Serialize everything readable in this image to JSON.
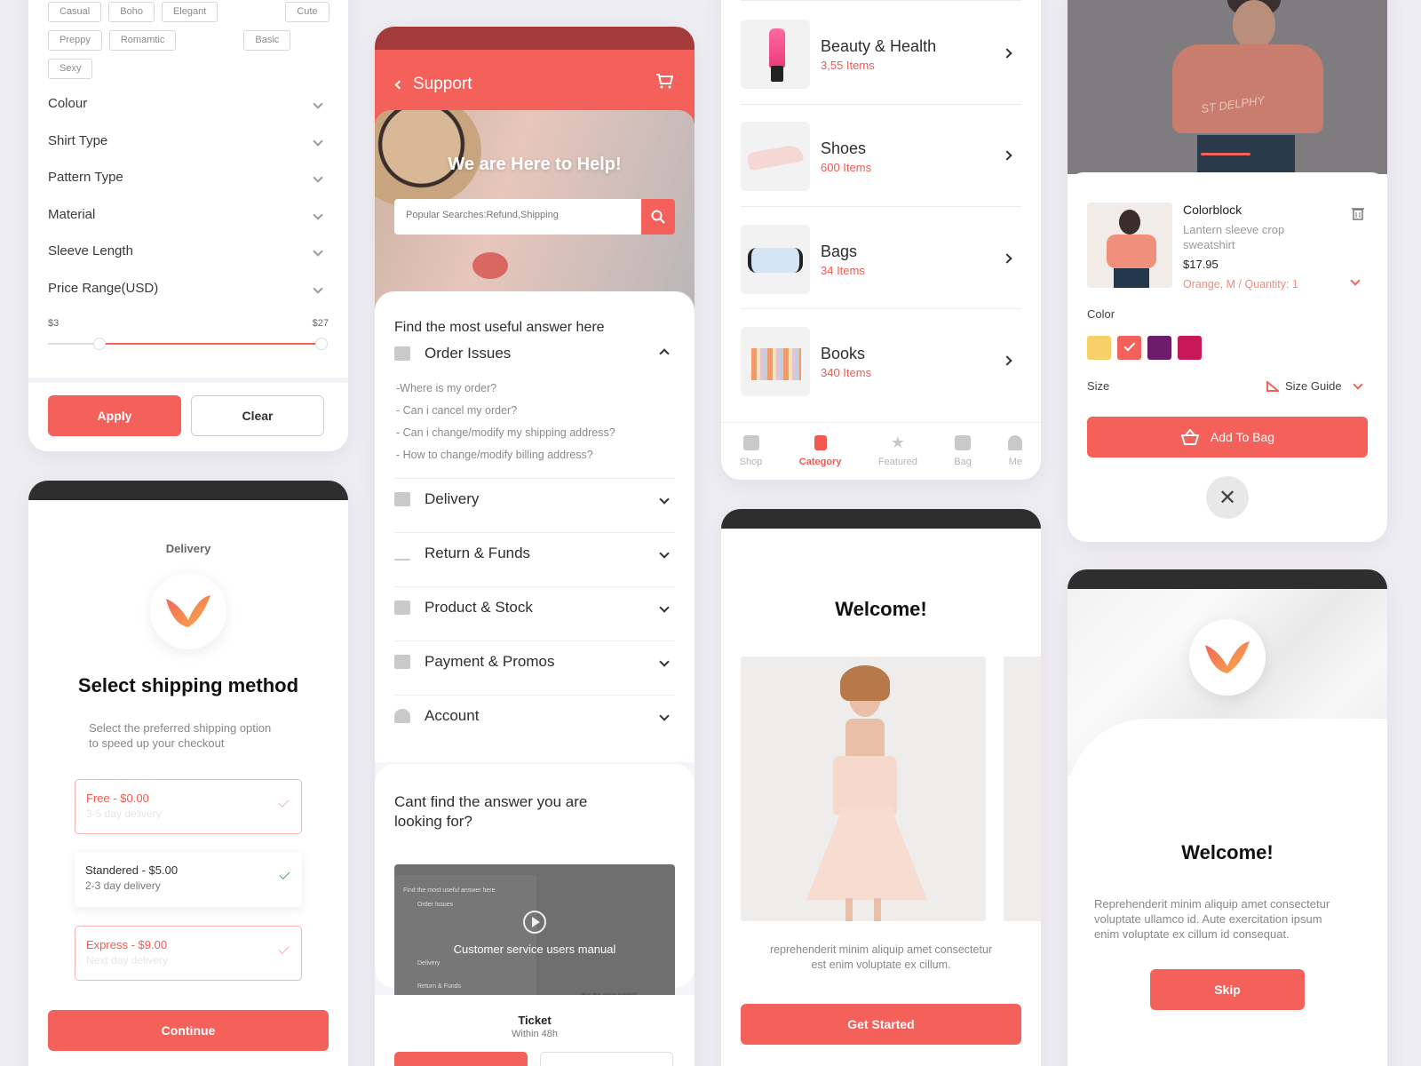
{
  "filter": {
    "tags": [
      "Casual",
      "Boho",
      "Elegant",
      "Cute",
      "Preppy",
      "Romamtic",
      "Basic",
      "Sexy"
    ],
    "rows": [
      "Colour",
      "Shirt Type",
      "Pattern Type",
      "Material",
      "Sleeve Length",
      "Price Range(USD)"
    ],
    "price_min": "$3",
    "price_max": "$27",
    "apply_label": "Apply",
    "clear_label": "Clear"
  },
  "shipping": {
    "header": "Delivery",
    "title": "Select shipping method",
    "subtitle_line1": "Select the preferred shipping option",
    "subtitle_line2": "to speed up your checkout",
    "options": [
      {
        "title": "Free - $0.00",
        "sub": "3-5 day delivery"
      },
      {
        "title": "Standered - $5.00",
        "sub": "2-3 day delivery"
      },
      {
        "title": "Express - $9.00",
        "sub": "Next day delivery"
      }
    ],
    "continue_label": "Continue"
  },
  "support": {
    "title": "Support",
    "hero_title": "We are Here to Help!",
    "search_placeholder": "Popular Searches:Refund,Shipping",
    "section_title": "Find the most useful answer here",
    "open_topic": "Order Issues",
    "questions": [
      "-Where is my order?",
      "- Can i cancel my order?",
      "- Can i change/modify my shipping address?",
      "- How to change/modify billing address?"
    ],
    "topics": [
      "Delivery",
      "Return & Funds",
      "Product & Stock",
      "Payment & Promos",
      "Account"
    ],
    "cant_find_line1": "Cant find the answer you are",
    "cant_find_line2": "looking for?",
    "video_caption": "Customer service users manual",
    "video_mini": {
      "title": "Find the most useful answer here",
      "topic": "Order Issues",
      "row1": "Delivery",
      "row2": "Return & Funds",
      "footer": "Was this article helpful?"
    },
    "ticket_title": "Ticket",
    "ticket_sub": "Within 48h"
  },
  "categories": {
    "items": [
      {
        "name": "Beauty & Health",
        "count": "3,55 Items"
      },
      {
        "name": "Shoes",
        "count": "600 Items"
      },
      {
        "name": "Bags",
        "count": "34 Items"
      },
      {
        "name": "Books",
        "count": "340 Items"
      }
    ],
    "tabs": [
      "Shop",
      "Category",
      "Featured",
      "Bag",
      "Me"
    ],
    "active_tab": "Category"
  },
  "welcome": {
    "title": "Welcome!",
    "text_line1": "reprehenderit minim aliquip amet consectetur",
    "text_line2": "est enim voluptate ex cillum.",
    "cta": "Get Started"
  },
  "product": {
    "photo_text": "ST DELPHY",
    "name": "Colorblock",
    "desc_line1": "Lantern sleeve crop",
    "desc_line2": "sweatshirt",
    "price": "$17.95",
    "variant": "Orange, M / Quantity: 1",
    "color_label": "Color",
    "swatches": [
      "#f7d06a",
      "#f4605a",
      "#6d1b6b",
      "#c8185a"
    ],
    "selected_swatch": 1,
    "size_label": "Size",
    "size_guide": "Size Guide",
    "add_to_bag": "Add To Bag"
  },
  "welcome2": {
    "title": "Welcome!",
    "text_line1": "Reprehenderit minim aliquip amet consectetur",
    "text_line2": "voluptate ullamco id. Aute exercitation ipsum",
    "text_line3": "enim voluptate ex cillum id consequat.",
    "skip": "Skip"
  },
  "colors": {
    "accent": "#f4605a",
    "dark_bar": "#2e2e2e",
    "success": "#3fb950"
  }
}
